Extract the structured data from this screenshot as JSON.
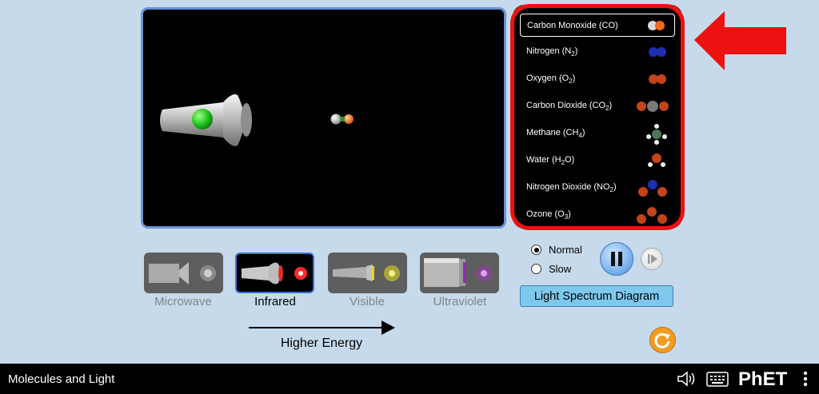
{
  "app": {
    "title": "Molecules and Light"
  },
  "molecules": [
    {
      "name": "Carbon Monoxide (CO)",
      "icon": "co-molecule-icon",
      "selected": true
    },
    {
      "name": "Nitrogen (N2)",
      "icon": "n2-molecule-icon",
      "selected": false
    },
    {
      "name": "Oxygen (O2)",
      "icon": "o2-molecule-icon",
      "selected": false
    },
    {
      "name": "Carbon Dioxide (CO2)",
      "icon": "co2-molecule-icon",
      "selected": false
    },
    {
      "name": "Methane (CH4)",
      "icon": "ch4-molecule-icon",
      "selected": false
    },
    {
      "name": "Water (H2O)",
      "icon": "h2o-molecule-icon",
      "selected": false
    },
    {
      "name": "Nitrogen Dioxide (NO2)",
      "icon": "no2-molecule-icon",
      "selected": false
    },
    {
      "name": "Ozone (O3)",
      "icon": "o3-molecule-icon",
      "selected": false
    }
  ],
  "light_sources": [
    {
      "label": "Microwave",
      "selected": false
    },
    {
      "label": "Infrared",
      "selected": true
    },
    {
      "label": "Visible",
      "selected": false
    },
    {
      "label": "Ultraviolet",
      "selected": false
    }
  ],
  "energy_arrow": {
    "label": "Higher Energy"
  },
  "speed": {
    "options": [
      "Normal",
      "Slow"
    ],
    "selected": "Normal"
  },
  "buttons": {
    "spectrum": "Light Spectrum Diagram"
  },
  "logo": {
    "text": "PhET"
  },
  "colors": {
    "annotation_red": "#ee1111",
    "selected_border": "#3b74d9",
    "spectrum_button": "#7ec8ee",
    "reset_orange": "#f39a1f"
  }
}
